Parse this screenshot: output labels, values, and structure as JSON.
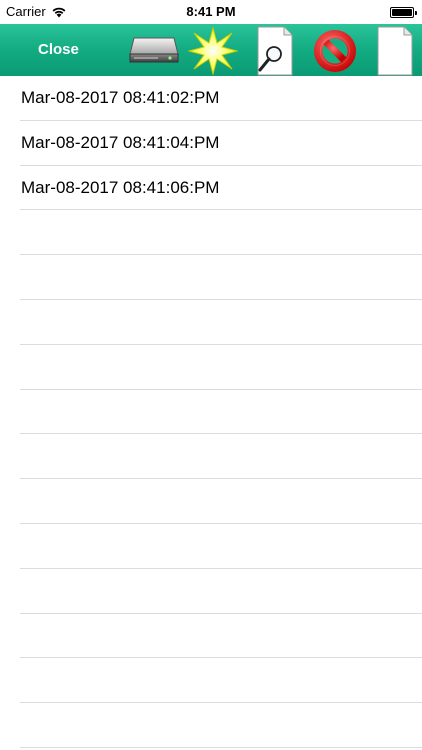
{
  "status_bar": {
    "carrier": "Carrier",
    "time": "8:41 PM"
  },
  "toolbar": {
    "close_label": "Close",
    "icons": [
      "disk-icon",
      "star-burst-icon",
      "search-document-icon",
      "cancel-icon",
      "document-icon"
    ],
    "accent_color": "#14ad84"
  },
  "list": {
    "items": [
      {
        "label": "Mar-08-2017 08:41:02:PM"
      },
      {
        "label": "Mar-08-2017 08:41:04:PM"
      },
      {
        "label": "Mar-08-2017 08:41:06:PM"
      },
      {
        "label": ""
      },
      {
        "label": ""
      },
      {
        "label": ""
      },
      {
        "label": ""
      },
      {
        "label": ""
      },
      {
        "label": ""
      },
      {
        "label": ""
      },
      {
        "label": ""
      },
      {
        "label": ""
      },
      {
        "label": ""
      },
      {
        "label": ""
      },
      {
        "label": ""
      }
    ]
  }
}
